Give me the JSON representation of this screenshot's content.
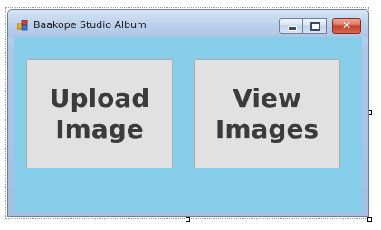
{
  "window": {
    "title": "Baakope Studio Album"
  },
  "caption_buttons": {
    "minimize_icon": "minimize-icon",
    "maximize_icon": "maximize-icon",
    "close_glyph": "✕"
  },
  "form": {
    "background_color": "#87ceeb",
    "buttons": [
      {
        "label": "Upload\nImage"
      },
      {
        "label": "View\nImages"
      }
    ]
  }
}
